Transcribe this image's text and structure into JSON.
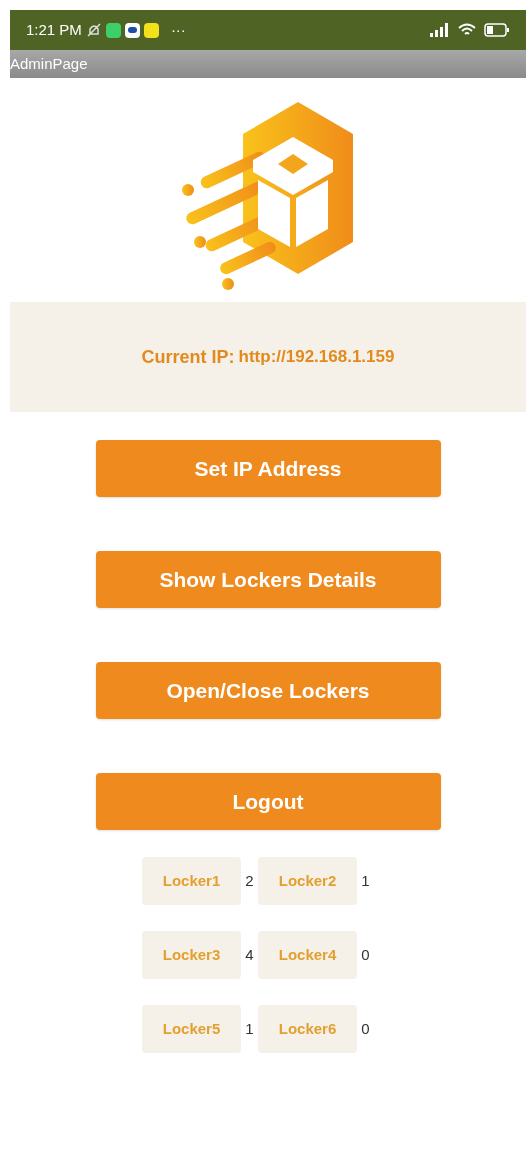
{
  "status_bar": {
    "time": "1:21 PM",
    "more": "···"
  },
  "title_bar": {
    "title": "AdminPage"
  },
  "ip_panel": {
    "label": "Current IP:",
    "value": "http://192.168.1.159"
  },
  "buttons": [
    "Set IP Address",
    "Show Lockers Details",
    "Open/Close Lockers",
    "Logout"
  ],
  "lockers": [
    {
      "label": "Locker1",
      "count": "2"
    },
    {
      "label": "Locker2",
      "count": "1"
    },
    {
      "label": "Locker3",
      "count": "4"
    },
    {
      "label": "Locker4",
      "count": "0"
    },
    {
      "label": "Locker5",
      "count": "1"
    },
    {
      "label": "Locker6",
      "count": "0"
    }
  ]
}
